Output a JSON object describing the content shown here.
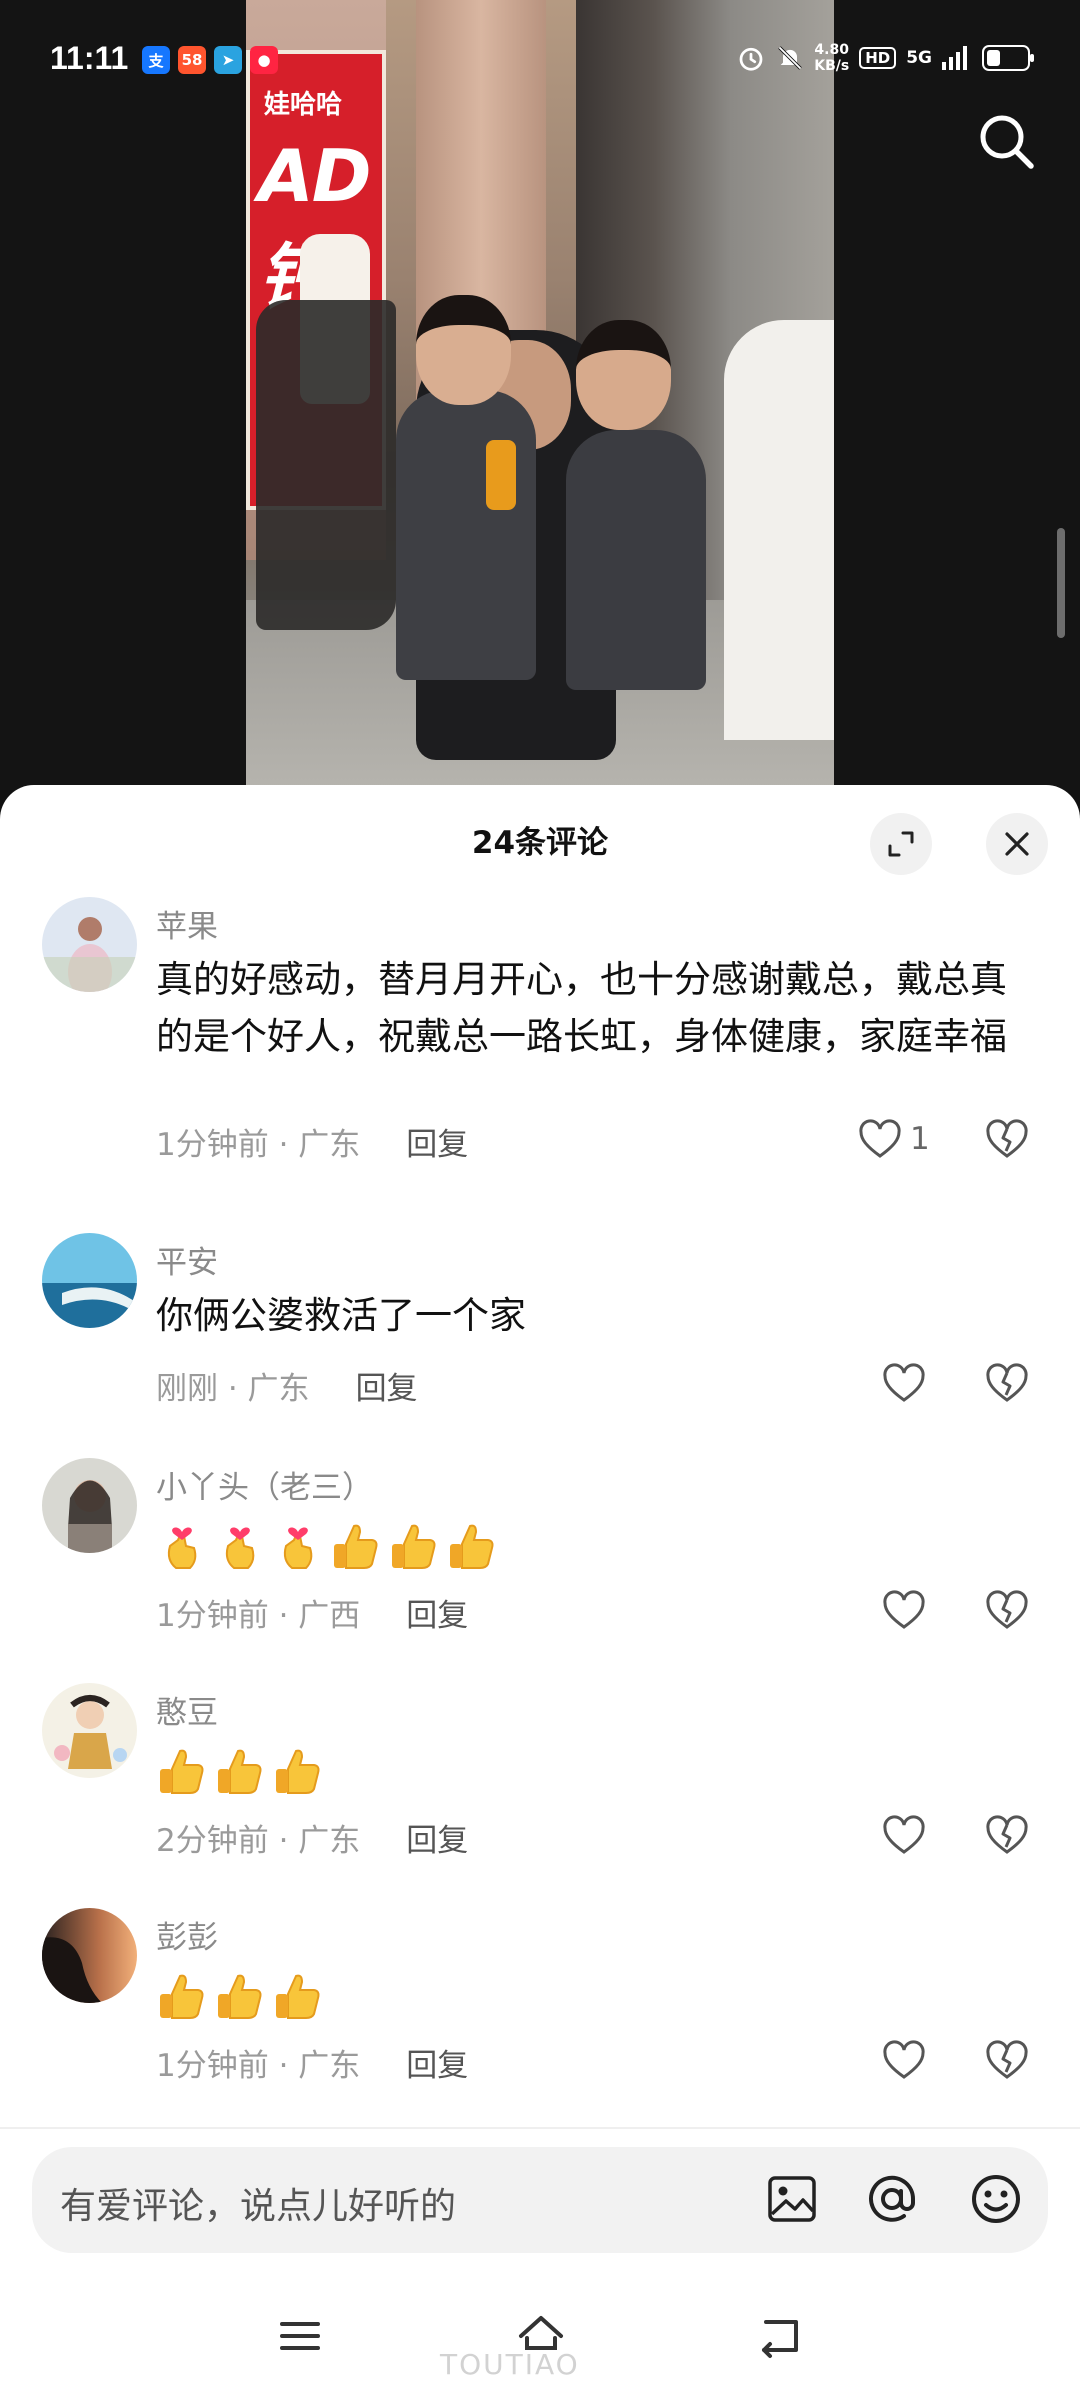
{
  "status_bar": {
    "time": "11:11",
    "apps": [
      {
        "name": "alipay-app-icon",
        "glyph": "支",
        "color": "#1677ff"
      },
      {
        "name": "58-app-icon",
        "glyph": "58",
        "color": "#ff552e"
      },
      {
        "name": "telegram-app-icon",
        "glyph": "➤",
        "color": "#2aa3e0"
      },
      {
        "name": "red-app-icon",
        "glyph": "●",
        "color": "#ff2442"
      }
    ],
    "net_speed_value": "4.80",
    "net_speed_unit": "KB/s",
    "hd": "HD",
    "network": "5G",
    "battery_level": 0.35
  },
  "comments_header": {
    "title": "24条评论"
  },
  "comments": [
    {
      "user": "苹果",
      "text": "真的好感动，替月月开心，也十分感谢戴总，戴总真的是个好人，祝戴总一路长虹，身体健康，家庭幸福",
      "time_location": "1分钟前 · 广东",
      "reply": "回复",
      "likes": "1",
      "avatar_colors": [
        "#dfe7f2",
        "#c9a6b3"
      ]
    },
    {
      "user": "平安",
      "text": "你俩公婆救活了一个家",
      "time_location": "刚刚 · 广东",
      "reply": "回复",
      "likes": "",
      "avatar_colors": [
        "#5fb3d9",
        "#1f7aa8"
      ]
    },
    {
      "user": "小丫头（老三）",
      "emojis": [
        "finger-heart",
        "finger-heart",
        "finger-heart",
        "thumbs-up",
        "thumbs-up",
        "thumbs-up"
      ],
      "time_location": "1分钟前 · 广西",
      "reply": "回复",
      "likes": "",
      "avatar_colors": [
        "#d8d8d2",
        "#8a8078"
      ]
    },
    {
      "user": "憨豆",
      "emojis": [
        "thumbs-up",
        "thumbs-up",
        "thumbs-up"
      ],
      "time_location": "2分钟前 · 广东",
      "reply": "回复",
      "likes": "",
      "avatar_colors": [
        "#f4f1e6",
        "#d9a64a"
      ]
    },
    {
      "user": "彭彭",
      "emojis": [
        "thumbs-up",
        "thumbs-up",
        "thumbs-up"
      ],
      "time_location": "1分钟前 · 广东",
      "reply": "回复",
      "likes": "",
      "avatar_colors": [
        "#e8a070",
        "#2a2220"
      ]
    }
  ],
  "input": {
    "placeholder": "有爱评论，说点儿好听的"
  },
  "video": {
    "ad_brand": "娃哈哈",
    "ad_product": "AD钙"
  },
  "watermark": "TOUTIAO"
}
